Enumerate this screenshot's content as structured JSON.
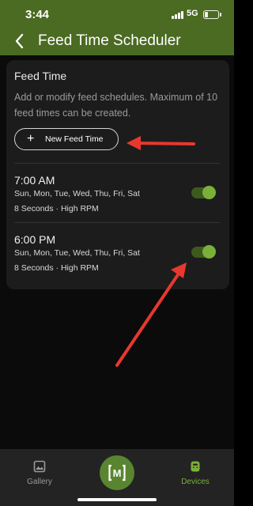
{
  "status_bar": {
    "time": "3:44",
    "network": "5G",
    "battery_level": 0.25
  },
  "header": {
    "back_icon": "chevron-left-icon",
    "title": "Feed Time Scheduler"
  },
  "card": {
    "title": "Feed Time",
    "description": "Add or modify feed schedules. Maximum of 10 feed times can be created.",
    "new_button": {
      "icon": "plus-icon",
      "label": "New Feed Time"
    },
    "schedules": [
      {
        "time": "7:00 AM",
        "days": "Sun, Mon, Tue, Wed, Thu, Fri, Sat",
        "details": "8 Seconds · High RPM",
        "enabled": true
      },
      {
        "time": "6:00 PM",
        "days": "Sun, Mon, Tue, Wed, Thu, Fri, Sat",
        "details": "8 Seconds · High RPM",
        "enabled": true
      }
    ]
  },
  "bottom_nav": {
    "items": [
      {
        "label": "Gallery",
        "icon": "image-icon",
        "active": false
      },
      {
        "label": "Devices",
        "icon": "device-icon",
        "active": true
      }
    ],
    "center": {
      "icon": "logo-icon",
      "text": "M"
    }
  },
  "colors": {
    "header_bg": "#4b6a22",
    "accent": "#7ab03a",
    "annotation_arrow": "#e8382e",
    "nav_active": "#7ab03a",
    "nav_inactive": "#9a9a9a"
  }
}
